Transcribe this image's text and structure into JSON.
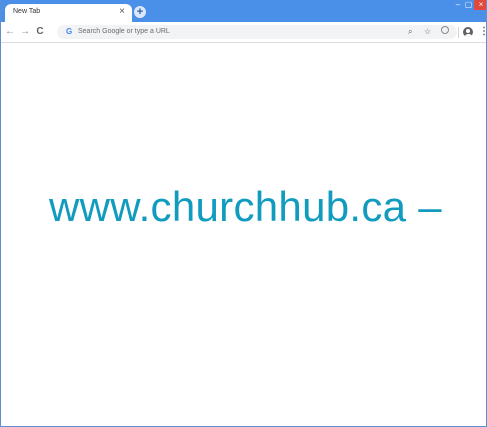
{
  "browser": {
    "tab": {
      "title": "New Tab",
      "close_glyph": "×"
    },
    "new_tab_glyph": "+",
    "window_controls": {
      "minimize": "–",
      "maximize": "▢",
      "close": "×"
    }
  },
  "toolbar": {
    "back_glyph": "←",
    "forward_glyph": "→",
    "reload_glyph": "C",
    "omnibox": {
      "icon_letter": "G",
      "placeholder": "Search Google or type a URL"
    },
    "zoom_glyph": "⌕",
    "star_glyph": "☆",
    "menu_glyph": "⋮",
    "icons": [
      "zoom-icon",
      "bookmark-star-icon",
      "extension-icon",
      "profile-icon",
      "menu-icon"
    ]
  },
  "content": {
    "overlay_text": "www.churchhub.ca –"
  },
  "colors": {
    "titlebar": "#4a8fe8",
    "close_button": "#e0493b",
    "overlay_text": "#119cbf",
    "omnibox_bg": "#f1f3f4"
  }
}
